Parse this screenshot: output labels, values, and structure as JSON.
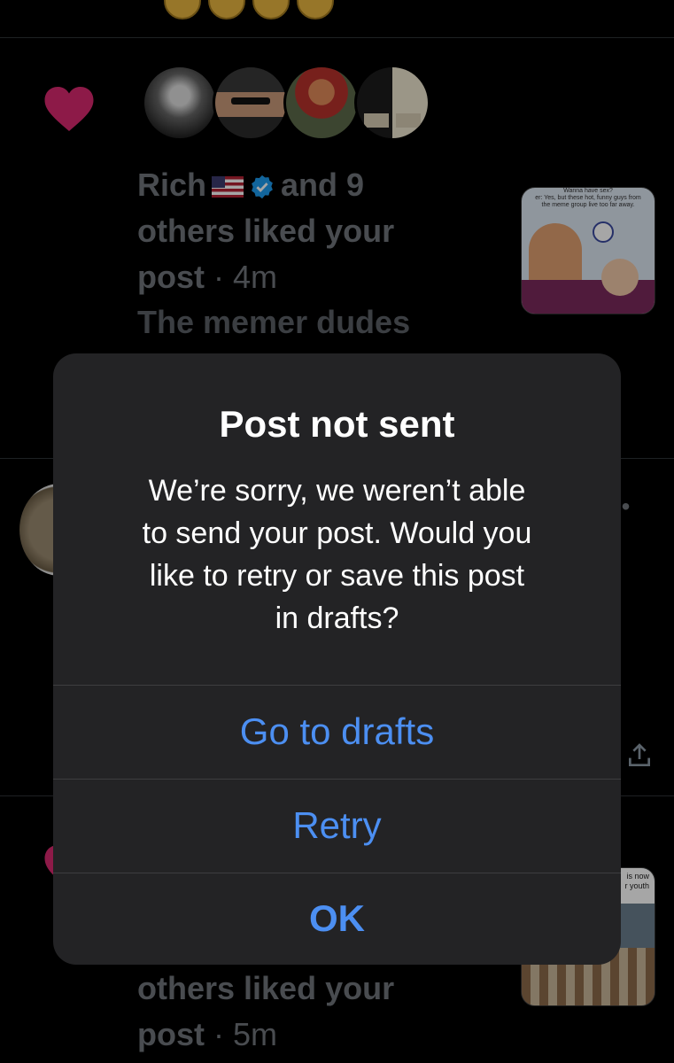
{
  "notifications": [
    {
      "name": "Rich",
      "action_text": "and 9 others liked your post",
      "time": "4m",
      "preview_text": "The memer dudes",
      "thumbnail_text": [
        "Wanna have sex?",
        "er: Yes, but these hot, funny guys from",
        "the meme group live too far away."
      ]
    },
    {
      "action_text": "others liked your post",
      "time": "5m",
      "thumbnail_text": [
        "is now",
        "r youth"
      ]
    }
  ],
  "dialog": {
    "title": "Post not sent",
    "message": "We’re sorry, we weren’t able\nto send your post. Would you\nlike to retry or save this post\nin drafts?",
    "buttons": {
      "go_to_drafts": "Go to drafts",
      "retry": "Retry",
      "ok": "OK"
    }
  },
  "colors": {
    "background": "#000000",
    "dialog_background": "#232325",
    "button_text": "#4c8ff2",
    "like_heart": "#d9286f",
    "muted_text": "#71767b"
  },
  "icons": [
    "heart-icon",
    "verified-badge-icon",
    "us-flag-icon",
    "share-icon",
    "more-icon"
  ]
}
